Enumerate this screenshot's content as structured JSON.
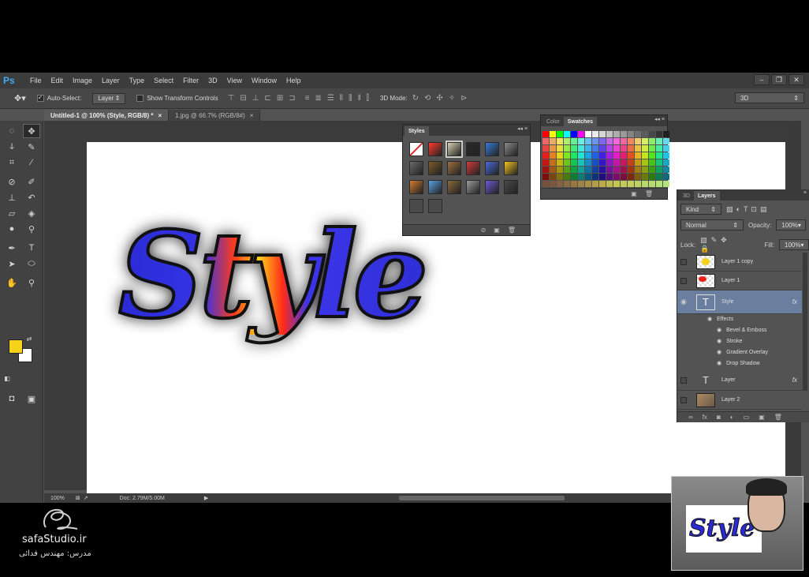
{
  "menubar": {
    "logo": "Ps",
    "items": [
      "File",
      "Edit",
      "Image",
      "Layer",
      "Type",
      "Select",
      "Filter",
      "3D",
      "View",
      "Window",
      "Help"
    ]
  },
  "options": {
    "auto_select_label": "Auto-Select:",
    "auto_select_value": "Layer",
    "show_transform_label": "Show Transform Controls",
    "mode_3d_label": "3D Mode:",
    "workspace": "3D"
  },
  "tabs": [
    {
      "label": "Untitled-1 @ 100% (Style, RGB/8) *",
      "active": true
    },
    {
      "label": "1.jpg @ 66.7% (RGB/8#)",
      "active": false
    }
  ],
  "canvas": {
    "text": "Style"
  },
  "status": {
    "zoom": "100%",
    "doc": "Doc: 2.79M/5.00M"
  },
  "colors": {
    "foreground": "#f6d31b",
    "background": "#ffffff"
  },
  "styles_panel": {
    "title": "Styles",
    "swatches": [
      "#ffffff",
      "#ff3a2a",
      "#d8d0b0",
      "#2a2a2a",
      "#3a7ad8",
      "#8a8a8a",
      "#6a6a6a",
      "#7a5a2a",
      "#a07040",
      "#d03a3a",
      "#4a6ad8",
      "#f0c020",
      "#d07a30",
      "#5aa0e0",
      "#8a6a3a",
      "#9a9a9a",
      "#6a5ad0",
      "#4a4a4a",
      "#4a4a4a",
      "#4a4a4a"
    ]
  },
  "color_panel": {
    "tab_color": "Color",
    "tab_swatches": "Swatches"
  },
  "layers_panel": {
    "tab_3d": "3D",
    "tab_layers": "Layers",
    "kind_filter": "Kind",
    "blend_mode": "Normal",
    "opacity_label": "Opacity:",
    "opacity_value": "100%",
    "lock_label": "Lock:",
    "fill_label": "Fill:",
    "fill_value": "100%",
    "layers": [
      {
        "name": "Layer 1 copy",
        "type": "image",
        "visible": false,
        "fx": false
      },
      {
        "name": "Layer 1",
        "type": "image",
        "visible": false,
        "fx": false
      },
      {
        "name": "Style",
        "type": "text",
        "visible": true,
        "fx": true,
        "selected": true
      },
      {
        "name": "Layer",
        "type": "text",
        "visible": false,
        "fx": true
      },
      {
        "name": "Layer 2",
        "type": "image",
        "visible": false,
        "fx": false
      }
    ],
    "effects_label": "Effects",
    "effects": [
      "Bevel & Emboss",
      "Stroke",
      "Gradient Overlay",
      "Drop Shadow"
    ],
    "fx_symbol": "fx"
  },
  "footer": {
    "brand": "safaStudio.ir",
    "teacher": "مدرس: مهندس فدائی"
  }
}
